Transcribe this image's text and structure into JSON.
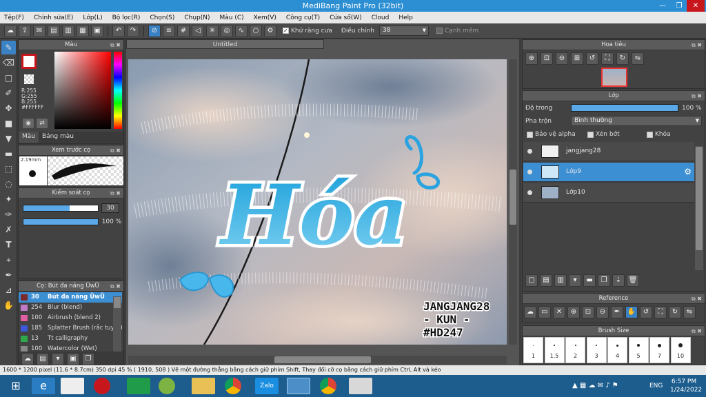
{
  "window": {
    "title": "MediBang Paint Pro (32bit)"
  },
  "menu": [
    "Tệp(F)",
    "Chỉnh sửa(E)",
    "Lớp(L)",
    "Bộ lọc(R)",
    "Chọn(S)",
    "Chụp(N)",
    "Màu (C)",
    "Xem(V)",
    "Công cụ(T)",
    "Cửa sổ(W)",
    "Cloud",
    "Help"
  ],
  "toolbar": {
    "antialias_label": "Khử răng cưa",
    "adjust_label": "Điều chỉnh",
    "adjust_value": "38",
    "sharp_edge_label": "Cạnh mềm"
  },
  "color_panel": {
    "title": "Màu",
    "r": "R:255",
    "g": "G:255",
    "b": "B:255",
    "hex": "#FFFFFF",
    "tab1": "Màu",
    "tab2": "Bảng màu",
    "fg_color": "#ffffff",
    "accent": "#c8161d"
  },
  "brush_preview": {
    "title": "Xem trước cọ",
    "size": "2.19mm"
  },
  "brush_control": {
    "title": "Kiểm soát cọ",
    "size_value": "30",
    "opacity_value": "100 %",
    "size_level": 0.62,
    "opacity_level": 1.0
  },
  "brush_list": {
    "title": "Cọ: Bút đa năng ŪwŪ",
    "items": [
      {
        "size": "30",
        "name": "Bút đa năng ŪwŪ",
        "color": "#7a2a2a",
        "selected": true
      },
      {
        "size": "254",
        "name": "Blur (blend)",
        "color": "#c07ac8",
        "selected": false
      },
      {
        "size": "100",
        "name": "Airbrush (blend 2)",
        "color": "#e05fa0",
        "selected": false
      },
      {
        "size": "185",
        "name": "Splatter Brush (rắc tuyết)",
        "color": "#3a58d8",
        "selected": false
      },
      {
        "size": "13",
        "name": "Tt calligraphy",
        "color": "#2ea84a",
        "selected": false
      },
      {
        "size": "100",
        "name": "Watercolor (Wet)",
        "color": "#888888",
        "selected": false
      }
    ]
  },
  "document": {
    "tab": "Untitled"
  },
  "canvas_art": {
    "title": "Hóa",
    "watermark_1": "JANGJANG28",
    "watermark_2": "- KUN -",
    "watermark_3": "#HD247"
  },
  "navigator": {
    "title": "Hoa tiêu"
  },
  "layers": {
    "title": "Lớp",
    "opacity_label": "Độ trong",
    "opacity_value": "100 %",
    "opacity_level": 1.0,
    "blend_label": "Pha trộn",
    "blend_value": "Bình thường",
    "protect_alpha": "Bảo vệ alpha",
    "clipping": "Xén bớt",
    "lock": "Khóa",
    "items": [
      {
        "name": "jangjang28",
        "selected": false
      },
      {
        "name": "Lớp9",
        "selected": true
      },
      {
        "name": "Lớp10",
        "selected": false
      }
    ]
  },
  "reference": {
    "title": "Reference"
  },
  "brush_size": {
    "title": "Brush Size",
    "sizes": [
      "1",
      "1.5",
      "2",
      "3",
      "4",
      "5",
      "7",
      "10"
    ]
  },
  "status": {
    "text": "1600 * 1200 pixel  (11.6 * 8.7cm)  350 dpi  45 %  ( 1910, 508 )  Vẽ một đường thẳng bằng cách giữ phím Shift, Thay đổi cỡ cọ bằng cách giữ phím Ctrl, Alt và kéo"
  },
  "taskbar": {
    "lang": "ENG",
    "time": "6:57 PM",
    "date": "1/24/2022"
  }
}
